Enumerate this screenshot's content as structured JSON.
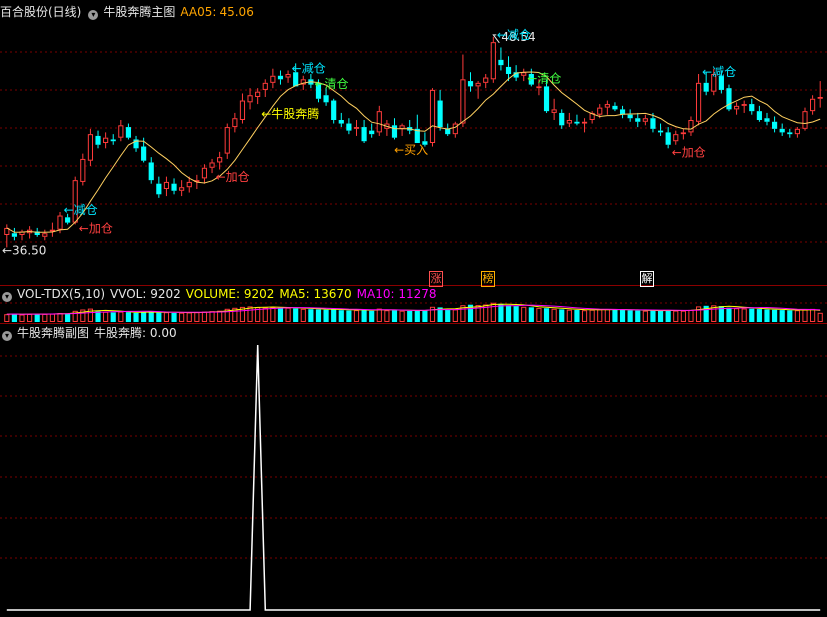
{
  "main_panel": {
    "title": "百合股份(日线)",
    "indicator": "牛股奔腾主图",
    "aa05_label": "AA05:",
    "aa05_value": "45.06"
  },
  "vol_panel": {
    "title": "VOL-TDX(5,10)",
    "vvol": "VVOL: 9202",
    "volume": "VOLUME: 9202",
    "ma5": "MA5: 13670",
    "ma10": "MA10: 11278"
  },
  "sub_panel": {
    "title": "牛股奔腾副图",
    "value": "牛股奔腾: 0.00"
  },
  "badges": [
    {
      "text": "涨",
      "color": "#ff5050"
    },
    {
      "text": "榜",
      "color": "#ffb000"
    },
    {
      "text": "解",
      "color": "#ffffff"
    }
  ],
  "colors": {
    "up": "#ff3b3b",
    "down": "#00ffff",
    "ma_line": "#ffd060",
    "vol_ma5": "#ffff00",
    "vol_ma10": "#ff00ff",
    "grid": "#7a0000",
    "annot_add": "#ff4040",
    "annot_reduce": "#00e5ff",
    "annot_clear": "#40ff40",
    "annot_signal": "#ffff00",
    "annot_buy": "#ffa000",
    "sub_line": "#ffffff"
  },
  "chart_data": [
    {
      "type": "candlestick",
      "title": "百合股份(日线)",
      "price_labels": {
        "low": "36.50",
        "high": "48.54"
      },
      "ohlc": [
        [
          37.3,
          37.9,
          36.6,
          37.7
        ],
        [
          37.4,
          37.7,
          37.0,
          37.2
        ],
        [
          37.3,
          37.6,
          37.0,
          37.5
        ],
        [
          37.4,
          37.8,
          37.1,
          37.6
        ],
        [
          37.5,
          37.7,
          37.2,
          37.3
        ],
        [
          37.2,
          37.6,
          37.0,
          37.4
        ],
        [
          37.5,
          38.0,
          37.2,
          37.6
        ],
        [
          37.6,
          38.6,
          37.4,
          38.4
        ],
        [
          38.3,
          38.5,
          37.9,
          38.0
        ],
        [
          38.0,
          40.6,
          37.9,
          40.4
        ],
        [
          40.3,
          41.9,
          40.1,
          41.6
        ],
        [
          41.5,
          43.3,
          41.2,
          43.0
        ],
        [
          42.9,
          43.2,
          42.2,
          42.4
        ],
        [
          42.5,
          43.1,
          42.2,
          42.8
        ],
        [
          42.7,
          43.0,
          42.4,
          42.6
        ],
        [
          42.8,
          43.8,
          42.6,
          43.5
        ],
        [
          43.4,
          43.6,
          42.7,
          42.8
        ],
        [
          42.7,
          42.9,
          42.0,
          42.2
        ],
        [
          42.3,
          42.8,
          41.4,
          41.5
        ],
        [
          41.4,
          41.7,
          40.2,
          40.4
        ],
        [
          40.2,
          40.6,
          39.4,
          39.6
        ],
        [
          39.9,
          40.6,
          39.5,
          40.3
        ],
        [
          40.2,
          40.5,
          39.6,
          39.8
        ],
        [
          39.8,
          40.4,
          39.5,
          40.0
        ],
        [
          40.0,
          40.6,
          39.7,
          40.3
        ],
        [
          40.3,
          40.7,
          39.9,
          40.4
        ],
        [
          40.5,
          41.3,
          40.2,
          41.1
        ],
        [
          41.1,
          41.6,
          40.8,
          41.4
        ],
        [
          41.4,
          42.0,
          41.0,
          41.7
        ],
        [
          41.9,
          43.6,
          41.6,
          43.4
        ],
        [
          43.4,
          44.2,
          43.1,
          43.9
        ],
        [
          43.8,
          45.3,
          43.6,
          44.9
        ],
        [
          44.8,
          45.6,
          44.4,
          45.2
        ],
        [
          45.1,
          45.6,
          44.7,
          45.4
        ],
        [
          45.5,
          46.1,
          45.1,
          45.9
        ],
        [
          45.9,
          46.7,
          45.6,
          46.3
        ],
        [
          46.3,
          46.6,
          45.8,
          46.1
        ],
        [
          46.2,
          46.6,
          45.9,
          46.4
        ],
        [
          46.5,
          47.0,
          45.7,
          45.7
        ],
        [
          45.8,
          46.3,
          45.5,
          46.1
        ],
        [
          46.1,
          46.4,
          45.6,
          45.8
        ],
        [
          45.9,
          46.1,
          44.8,
          45.0
        ],
        [
          45.2,
          45.6,
          44.6,
          44.8
        ],
        [
          44.9,
          45.0,
          43.6,
          43.8
        ],
        [
          43.8,
          44.2,
          43.4,
          43.6
        ],
        [
          43.6,
          43.9,
          43.0,
          43.2
        ],
        [
          43.3,
          43.8,
          42.9,
          43.4
        ],
        [
          43.4,
          43.8,
          42.5,
          42.6
        ],
        [
          43.2,
          43.6,
          42.8,
          43.0
        ],
        [
          43.1,
          44.6,
          42.9,
          44.3
        ],
        [
          43.3,
          43.8,
          42.9,
          43.6
        ],
        [
          43.5,
          43.9,
          42.7,
          42.8
        ],
        [
          43.3,
          43.6,
          42.9,
          43.5
        ],
        [
          43.4,
          43.8,
          43.0,
          43.2
        ],
        [
          43.3,
          44.1,
          42.5,
          42.5
        ],
        [
          42.6,
          43.1,
          42.3,
          42.4
        ],
        [
          42.5,
          45.6,
          42.3,
          45.5
        ],
        [
          44.9,
          45.5,
          43.2,
          43.4
        ],
        [
          43.3,
          43.6,
          42.9,
          43.0
        ],
        [
          43.0,
          43.7,
          42.8,
          43.6
        ],
        [
          43.6,
          47.5,
          43.4,
          46.1
        ],
        [
          46.0,
          46.5,
          45.4,
          45.7
        ],
        [
          45.7,
          46.0,
          45.0,
          45.9
        ],
        [
          45.9,
          46.4,
          45.6,
          46.2
        ],
        [
          46.1,
          48.5,
          45.9,
          48.2
        ],
        [
          47.2,
          47.9,
          46.6,
          46.9
        ],
        [
          46.8,
          47.4,
          46.0,
          46.4
        ],
        [
          46.5,
          46.9,
          46.0,
          46.2
        ],
        [
          46.3,
          46.7,
          46.0,
          46.5
        ],
        [
          46.4,
          46.7,
          45.7,
          45.8
        ],
        [
          45.6,
          46.1,
          45.2,
          45.7
        ],
        [
          45.7,
          46.1,
          44.2,
          44.3
        ],
        [
          44.2,
          45.0,
          43.8,
          44.4
        ],
        [
          44.2,
          44.4,
          43.3,
          43.5
        ],
        [
          43.6,
          44.2,
          43.4,
          43.8
        ],
        [
          43.7,
          44.1,
          43.5,
          43.6
        ],
        [
          43.6,
          43.9,
          43.1,
          43.7
        ],
        [
          43.8,
          44.3,
          43.6,
          44.2
        ],
        [
          44.1,
          44.7,
          43.9,
          44.5
        ],
        [
          44.5,
          44.9,
          44.1,
          44.7
        ],
        [
          44.6,
          44.8,
          44.3,
          44.4
        ],
        [
          44.4,
          44.6,
          43.9,
          44.1
        ],
        [
          44.1,
          44.4,
          43.7,
          43.9
        ],
        [
          43.9,
          44.2,
          43.4,
          43.7
        ],
        [
          43.7,
          44.1,
          43.5,
          43.9
        ],
        [
          43.9,
          44.2,
          43.1,
          43.3
        ],
        [
          43.2,
          43.6,
          42.9,
          43.1
        ],
        [
          43.1,
          43.4,
          42.2,
          42.4
        ],
        [
          42.6,
          43.2,
          42.4,
          43.0
        ],
        [
          43.0,
          43.3,
          42.7,
          43.1
        ],
        [
          43.1,
          44.0,
          42.9,
          43.8
        ],
        [
          43.7,
          46.4,
          43.5,
          45.9
        ],
        [
          45.9,
          46.5,
          45.2,
          45.4
        ],
        [
          45.4,
          46.7,
          45.2,
          46.4
        ],
        [
          46.3,
          46.6,
          45.3,
          45.5
        ],
        [
          45.6,
          45.8,
          44.3,
          44.4
        ],
        [
          44.4,
          44.8,
          44.1,
          44.6
        ],
        [
          44.6,
          44.9,
          44.2,
          44.7
        ],
        [
          44.7,
          45.0,
          44.1,
          44.3
        ],
        [
          44.3,
          44.6,
          43.7,
          43.8
        ],
        [
          43.9,
          44.2,
          43.5,
          43.7
        ],
        [
          43.7,
          44.0,
          43.1,
          43.3
        ],
        [
          43.3,
          43.6,
          42.9,
          43.1
        ],
        [
          43.1,
          43.3,
          42.8,
          43.0
        ],
        [
          43.0,
          43.4,
          42.8,
          43.3
        ],
        [
          43.3,
          44.5,
          43.2,
          44.3
        ],
        [
          44.3,
          45.2,
          44.1,
          45.0
        ],
        [
          45.0,
          46.0,
          44.5,
          45.1
        ]
      ],
      "annotations": [
        {
          "bar": 0,
          "text": "←36.50",
          "kind": "price_low"
        },
        {
          "bar": 64,
          "text": "48.54",
          "kind": "price_high"
        },
        {
          "bar": 7,
          "text": "←减仓",
          "kind": "reduce"
        },
        {
          "bar": 9,
          "text": "←加仓",
          "kind": "add"
        },
        {
          "bar": 27,
          "text": "←加仓",
          "kind": "add"
        },
        {
          "bar": 33,
          "text": "←牛股奔腾",
          "kind": "signal"
        },
        {
          "bar": 37,
          "text": "←减仓",
          "kind": "reduce"
        },
        {
          "bar": 40,
          "text": "←清仓",
          "kind": "clear"
        },
        {
          "bar": 52,
          "text": "←买入",
          "kind": "buy"
        },
        {
          "bar": 64,
          "text": "←减仓",
          "kind": "reduce"
        },
        {
          "bar": 68,
          "text": "←清仓",
          "kind": "clear"
        },
        {
          "bar": 87,
          "text": "←加仓",
          "kind": "add"
        },
        {
          "bar": 91,
          "text": "←减仓",
          "kind": "reduce"
        }
      ]
    },
    {
      "type": "bar",
      "title": "VOL-TDX(5,10)",
      "series": [
        {
          "name": "VOLUME",
          "values": [
            7800,
            8200,
            7500,
            8000,
            7900,
            8100,
            8300,
            9000,
            8600,
            11200,
            12500,
            13400,
            10800,
            10200,
            9600,
            10400,
            9800,
            9200,
            10100,
            10600,
            9400,
            9800,
            9000,
            9300,
            9600,
            9800,
            10400,
            10900,
            11300,
            13200,
            14200,
            15100,
            15600,
            14800,
            14400,
            15000,
            14100,
            14300,
            13600,
            13200,
            12800,
            12600,
            12300,
            12900,
            11800,
            11500,
            11900,
            12400,
            11200,
            13400,
            11800,
            11600,
            11300,
            11100,
            11900,
            11400,
            15200,
            14600,
            12200,
            12600,
            16800,
            17300,
            16900,
            17500,
            19200,
            18200,
            16800,
            15900,
            15200,
            14700,
            14100,
            13800,
            13200,
            12600,
            12300,
            12000,
            11800,
            12300,
            12700,
            12900,
            12400,
            12000,
            11700,
            11400,
            11300,
            11600,
            11200,
            11800,
            11400,
            11300,
            12100,
            15600,
            16200,
            16700,
            15900,
            14300,
            13800,
            13500,
            13300,
            12900,
            12500,
            12200,
            11900,
            11700,
            11800,
            12400,
            13100,
            9202
          ]
        },
        {
          "name": "MA5",
          "values": [
            13670
          ]
        },
        {
          "name": "MA10",
          "values": [
            11278
          ]
        }
      ]
    },
    {
      "type": "line",
      "title": "牛股奔腾副图",
      "series": [
        {
          "name": "牛股奔腾",
          "spike_bar": 33,
          "spike_value": 1.0,
          "baseline": 0.0
        }
      ]
    }
  ]
}
